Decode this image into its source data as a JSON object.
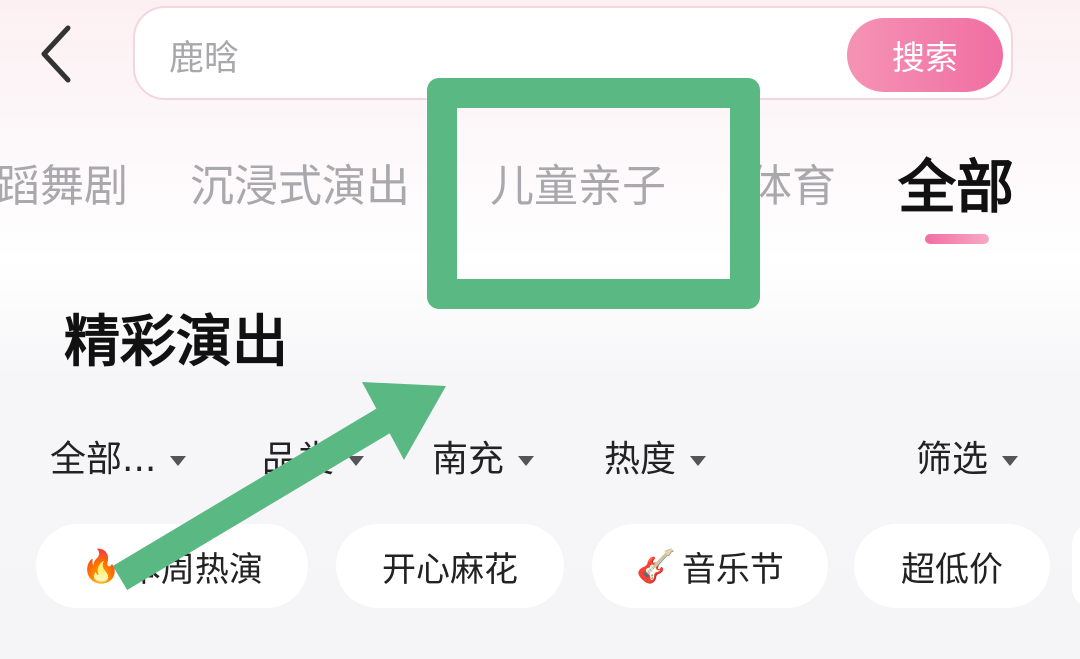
{
  "search": {
    "value": "鹿晗",
    "button_label": "搜索"
  },
  "category_tabs": [
    {
      "label": "蹈舞剧"
    },
    {
      "label": "沉浸式演出"
    },
    {
      "label": "儿童亲子"
    },
    {
      "label": "体育"
    }
  ],
  "active_tab": {
    "label": "全部"
  },
  "section": {
    "title": "精彩演出"
  },
  "filters": [
    {
      "label": "全部..."
    },
    {
      "label": "品类"
    },
    {
      "label": "南充"
    },
    {
      "label": "热度"
    },
    {
      "label": "筛选"
    }
  ],
  "chips": [
    {
      "icon": "🔥",
      "label": "本周热演"
    },
    {
      "icon": "",
      "label": "开心麻花"
    },
    {
      "icon": "🎸",
      "label": "音乐节"
    },
    {
      "icon": "",
      "label": "超低价"
    }
  ],
  "colors": {
    "accent_pink": "#f06ea2",
    "annotation_green": "#5ab883"
  }
}
